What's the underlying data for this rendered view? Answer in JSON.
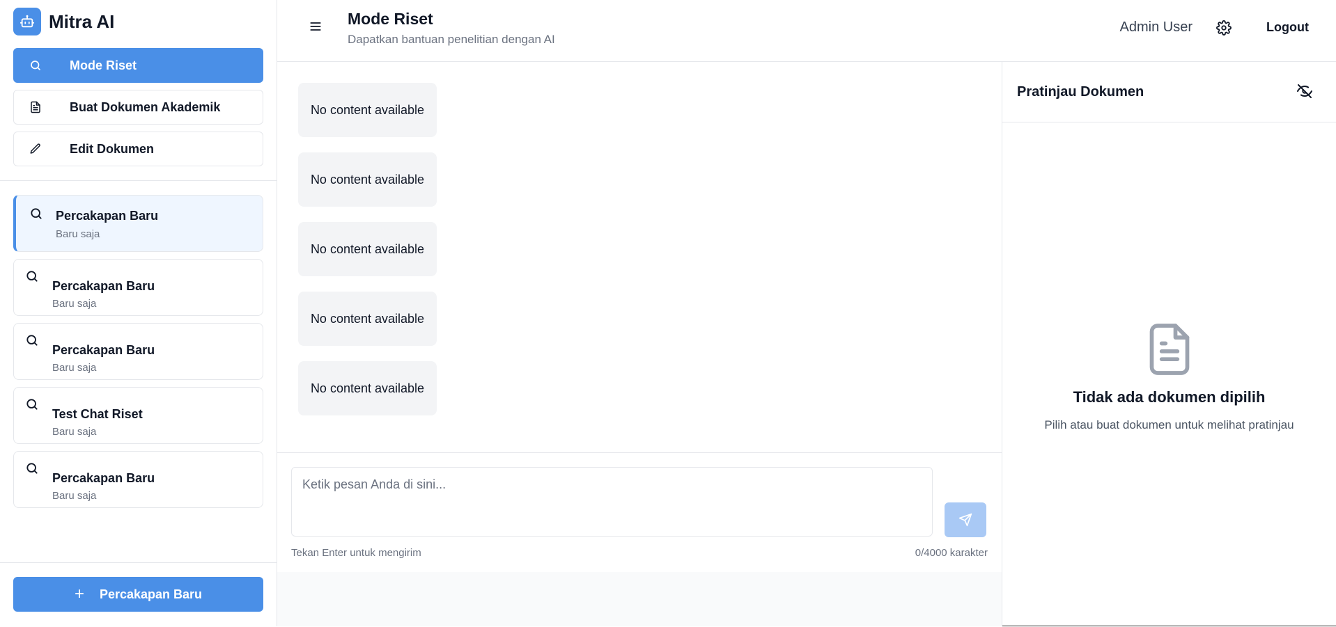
{
  "brand": {
    "name": "Mitra AI",
    "icon": "robot-icon"
  },
  "modes": [
    {
      "label": "Mode Riset",
      "icon": "search-icon",
      "active": true
    },
    {
      "label": "Buat Dokumen Akademik",
      "icon": "document-icon",
      "active": false
    },
    {
      "label": "Edit Dokumen",
      "icon": "pen-icon",
      "active": false
    }
  ],
  "conversations": [
    {
      "title": "Percakapan Baru",
      "time": "Baru saja",
      "active": true
    },
    {
      "title": "Percakapan Baru",
      "time": "Baru saja",
      "active": false
    },
    {
      "title": "Percakapan Baru",
      "time": "Baru saja",
      "active": false
    },
    {
      "title": "Test Chat Riset",
      "time": "Baru saja",
      "active": false
    },
    {
      "title": "Percakapan Baru",
      "time": "Baru saja",
      "active": false
    }
  ],
  "new_chat": {
    "label": "Percakapan Baru"
  },
  "header": {
    "title": "Mode Riset",
    "subtitle": "Dapatkan bantuan penelitian dengan AI",
    "user": "Admin User",
    "logout": "Logout"
  },
  "messages": [
    "No content available",
    "No content available",
    "No content available",
    "No content available",
    "No content available"
  ],
  "composer": {
    "placeholder": "Ketik pesan Anda di sini...",
    "hint": "Tekan Enter untuk mengirim",
    "count": "0/4000 karakter"
  },
  "preview": {
    "title": "Pratinjau Dokumen",
    "empty_title": "Tidak ada dokumen dipilih",
    "empty_sub": "Pilih atau buat dokumen untuk melihat pratinjau"
  },
  "colors": {
    "accent": "#4a8fe7",
    "accent_light": "#a9c9f5",
    "active_bg": "#eff6ff"
  }
}
